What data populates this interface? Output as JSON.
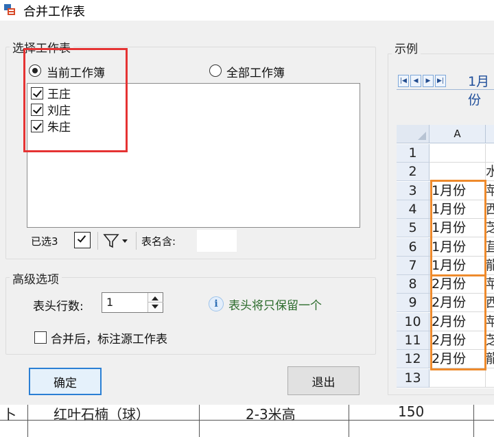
{
  "window": {
    "title": "合并工作表"
  },
  "select_group": {
    "title": "选择工作表",
    "radio_current": "当前工作簿",
    "radio_all": "全部工作簿",
    "sheets": [
      {
        "label": "王庄",
        "checked": true
      },
      {
        "label": "刘庄",
        "checked": true
      },
      {
        "label": "朱庄",
        "checked": true
      }
    ],
    "selected_count": "已选3",
    "name_contains_label": "表名含:"
  },
  "advanced_group": {
    "title": "高级选项",
    "header_rows_label": "表头行数:",
    "header_rows_value": "1",
    "info_text": "表头将只保留一个",
    "mark_source_label": "合并后，标注源工作表"
  },
  "buttons": {
    "ok": "确定",
    "exit": "退出"
  },
  "example": {
    "title": "示例",
    "tab_label": "1月份",
    "column_header": "A",
    "rows": [
      {
        "num": "1",
        "a": "",
        "b": ""
      },
      {
        "num": "2",
        "a": "",
        "b": "水"
      },
      {
        "num": "3",
        "a": "1月份",
        "b": "苹"
      },
      {
        "num": "4",
        "a": "1月份",
        "b": "西"
      },
      {
        "num": "5",
        "a": "1月份",
        "b": "芝"
      },
      {
        "num": "6",
        "a": "1月份",
        "b": "苴"
      },
      {
        "num": "7",
        "a": "1月份",
        "b": "龍"
      },
      {
        "num": "8",
        "a": "2月份",
        "b": "苹"
      },
      {
        "num": "9",
        "a": "2月份",
        "b": "西"
      },
      {
        "num": "10",
        "a": "2月份",
        "b": "苹"
      },
      {
        "num": "11",
        "a": "2月份",
        "b": "芝"
      },
      {
        "num": "12",
        "a": "2月份",
        "b": "龍"
      },
      {
        "num": "13",
        "a": "",
        "b": ""
      }
    ]
  },
  "background_sheet": {
    "cells": [
      "卜",
      "红叶石楠（球）",
      "2-3米高",
      "150"
    ]
  },
  "colors": {
    "highlight_red": "#e53333",
    "highlight_orange": "#ee8a2c",
    "accent_blue": "#2a7fd4",
    "info_green": "#2b6b2b"
  }
}
